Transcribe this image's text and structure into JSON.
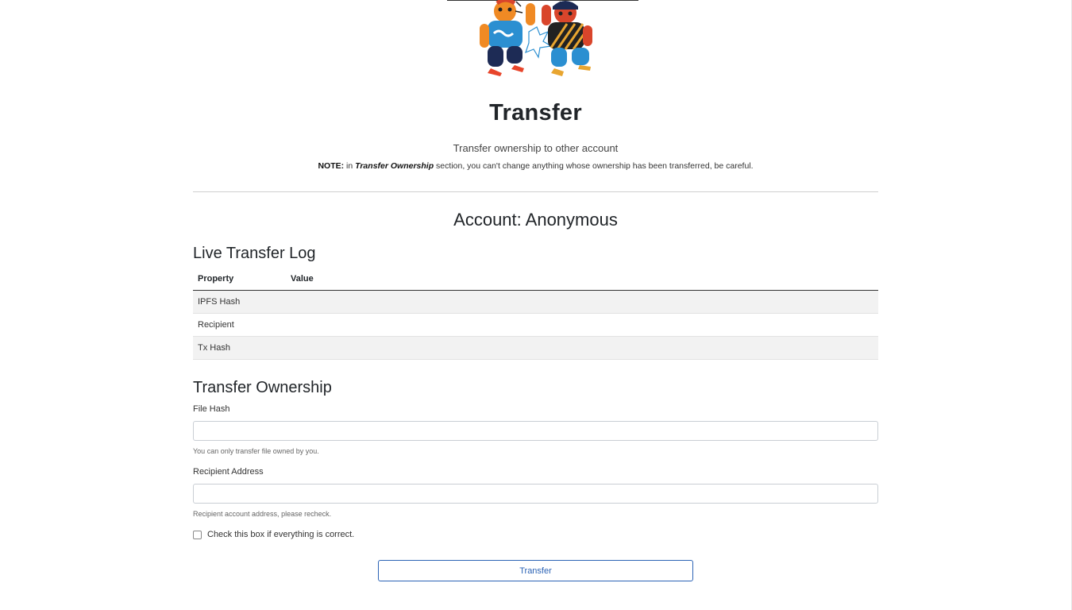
{
  "header": {
    "title": "Transfer",
    "subtitle": "Transfer ownership to other account",
    "note": {
      "prefix": "NOTE:",
      "part1": " in ",
      "emphasis": "Transfer Ownership",
      "part2": " section, you can't change anything whose ownership has been transferred, be careful."
    }
  },
  "account": {
    "title": "Account: Anonymous"
  },
  "log": {
    "title": "Live Transfer Log",
    "columns": [
      "Property",
      "Value"
    ],
    "rows": [
      {
        "property": "IPFS Hash",
        "value": ""
      },
      {
        "property": "Recipient",
        "value": ""
      },
      {
        "property": "Tx Hash",
        "value": ""
      }
    ]
  },
  "form": {
    "title": "Transfer Ownership",
    "file_hash": {
      "label": "File Hash",
      "value": "",
      "placeholder": "",
      "help": "You can only transfer file owned by you."
    },
    "recipient": {
      "label": "Recipient Address",
      "value": "",
      "placeholder": "",
      "help": "Recipient account address, please recheck."
    },
    "confirm_label": "Check this box if everything is correct.",
    "confirm_checked": false,
    "submit_label": "Transfer"
  },
  "colors": {
    "accent": "#2b63b5",
    "table_stripe": "#f2f2f2",
    "text": "#212529"
  },
  "icons": {
    "hero": "high-five-characters-illustration"
  }
}
